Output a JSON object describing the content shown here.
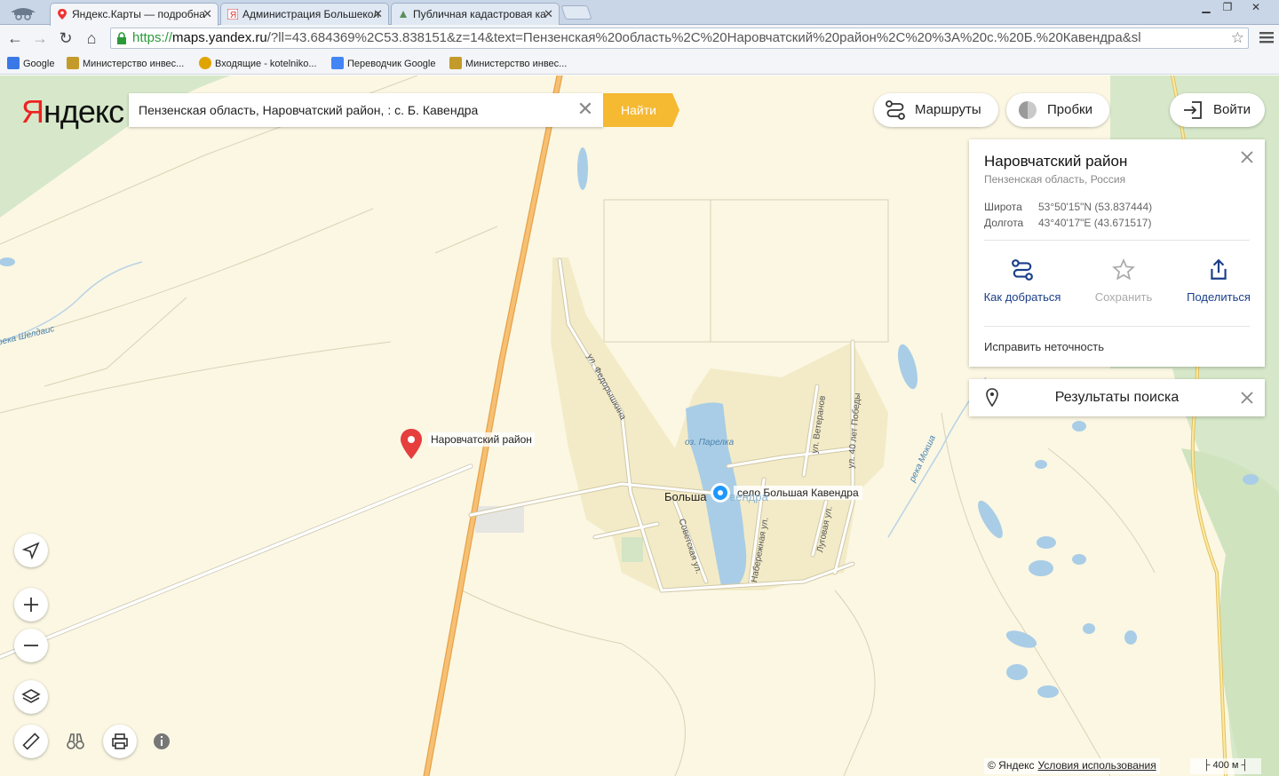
{
  "browser": {
    "tabs": [
      {
        "title": "Яндекс.Карты — подробна",
        "active": true
      },
      {
        "title": "Администрация Большекол",
        "active": false
      },
      {
        "title": "Публичная кадастровая ка",
        "active": false
      }
    ],
    "address": {
      "scheme": "https://",
      "host": "maps.yandex.ru",
      "rest": "/?ll=43.684369%2C53.838151&z=14&text=Пензенская%20область%2C%20Наровчатский%20район%2C%20%3A%20с.%20Б.%20Кавендра&sl"
    },
    "bookmarks": [
      {
        "label": "Google",
        "icon": "google-icon",
        "color": "#3b78e7"
      },
      {
        "label": "Министерство инвес...",
        "icon": "crest-icon",
        "color": "#c49a2a"
      },
      {
        "label": "Входящие - kotelniko...",
        "icon": "mail-at-icon",
        "color": "#e0a400"
      },
      {
        "label": "Переводчик Google",
        "icon": "translate-icon",
        "color": "#4285f4"
      },
      {
        "label": "Министерство инвес...",
        "icon": "crest-icon",
        "color": "#c49a2a"
      }
    ]
  },
  "yandex": {
    "logo_first": "Я",
    "logo_rest": "ндекс",
    "search": {
      "value": "Пензенская область, Наровчатский район, : с. Б. Кавендра",
      "button": "Найти"
    },
    "routes_label": "Маршруты",
    "traffic_label": "Пробки",
    "login_label": "Войти",
    "accent": "#ffcc00",
    "search_button_color": "#f5b932"
  },
  "place_card": {
    "title": "Наровчатский район",
    "subtitle": "Пензенская область, Россия",
    "lat_label": "Широта",
    "lat_value": "53°50'15\"N (53.837444)",
    "lon_label": "Долгота",
    "lon_value": "43°40'17\"E (43.671517)",
    "actions": [
      {
        "label": "Как добраться",
        "icon": "route-icon",
        "enabled": true
      },
      {
        "label": "Сохранить",
        "icon": "star-icon",
        "enabled": false
      },
      {
        "label": "Поделиться",
        "icon": "share-icon",
        "enabled": true
      }
    ],
    "fix_label": "Исправить неточность"
  },
  "results_panel": {
    "label": "Результаты поиска"
  },
  "map_labels": {
    "district_pin": "Наровчатский район",
    "village_pin": "село Большая Кавендра",
    "town_visible": "Больша",
    "town_faded": "вендра",
    "lake": "оз. Парелка",
    "river_mokshi": "река Мокша",
    "river_sheldais": "река Шелдаис",
    "streets": [
      "ул. Федорышкина",
      "Советская ул.",
      "Набережная ул.",
      "ул. Ветеранов",
      "ул. 40 лет Победы",
      "Луговая ул."
    ]
  },
  "footer": {
    "copyright": "© Яндекс",
    "terms": "Условия использования",
    "scale": "400 м"
  }
}
